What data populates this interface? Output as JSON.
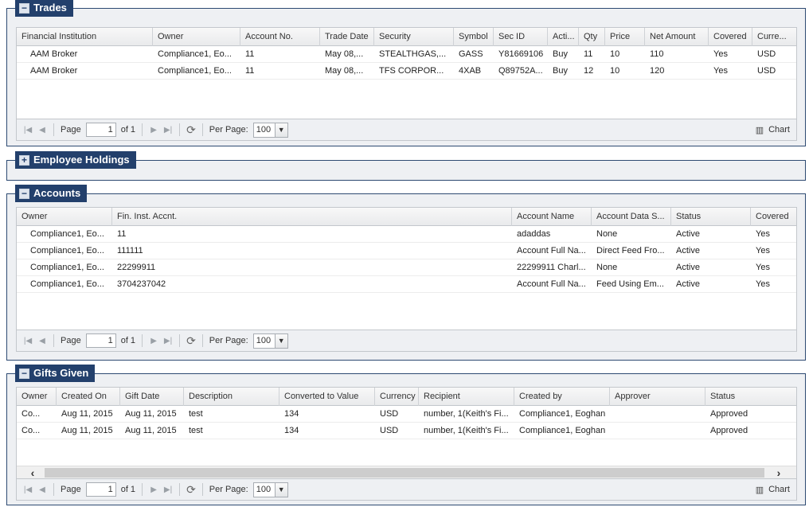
{
  "trades": {
    "title": "Trades",
    "columns": [
      "Financial Institution",
      "Owner",
      "Account No.",
      "Trade Date",
      "Security",
      "Symbol",
      "Sec ID",
      "Acti...",
      "Qty",
      "Price",
      "Net Amount",
      "Covered",
      "Curre..."
    ],
    "rows": [
      [
        "AAM Broker",
        "Compliance1, Eo...",
        "11",
        "May 08,...",
        "STEALTHGAS,...",
        "GASS",
        "Y81669106",
        "Buy",
        "11",
        "10",
        "110",
        "Yes",
        "USD"
      ],
      [
        "AAM Broker",
        "Compliance1, Eo...",
        "11",
        "May 08,...",
        "TFS CORPOR...",
        "4XAB",
        "Q89752A...",
        "Buy",
        "12",
        "10",
        "120",
        "Yes",
        "USD"
      ]
    ],
    "pager": {
      "page_label": "Page",
      "page_value": "1",
      "of_label": "of 1",
      "per_page_label": "Per Page:",
      "per_page_value": "100",
      "chart_label": "Chart"
    }
  },
  "holdings": {
    "title": "Employee Holdings"
  },
  "accounts": {
    "title": "Accounts",
    "columns": [
      "Owner",
      "Fin. Inst. Accnt.",
      "Account Name",
      "Account Data S...",
      "Status",
      "Covered"
    ],
    "rows": [
      [
        "Compliance1, Eo...",
        "11",
        "adaddas",
        "None",
        "Active",
        "Yes"
      ],
      [
        "Compliance1, Eo...",
        "111111",
        "Account Full Na...",
        "Direct Feed Fro...",
        "Active",
        "Yes"
      ],
      [
        "Compliance1, Eo...",
        "22299911",
        "22299911 Charl...",
        "None",
        "Active",
        "Yes"
      ],
      [
        "Compliance1, Eo...",
        "3704237042",
        "Account Full Na...",
        "Feed Using Em...",
        "Active",
        "Yes"
      ]
    ],
    "pager": {
      "page_label": "Page",
      "page_value": "1",
      "of_label": "of 1",
      "per_page_label": "Per Page:",
      "per_page_value": "100"
    }
  },
  "gifts": {
    "title": "Gifts Given",
    "columns": [
      "Owner",
      "Created On",
      "Gift Date",
      "Description",
      "Converted to Value",
      "Currency",
      "Recipient",
      "Created by",
      "Approver",
      "Status"
    ],
    "rows": [
      [
        "Co...",
        "Aug 11, 2015",
        "Aug 11, 2015",
        "test",
        "134",
        "USD",
        "number, 1(Keith's Fi...",
        "Compliance1, Eoghan",
        "",
        "Approved"
      ],
      [
        "Co...",
        "Aug 11, 2015",
        "Aug 11, 2015",
        "test",
        "134",
        "USD",
        "number, 1(Keith's Fi...",
        "Compliance1, Eoghan",
        "",
        "Approved"
      ]
    ],
    "pager": {
      "page_label": "Page",
      "page_value": "1",
      "of_label": "of 1",
      "per_page_label": "Per Page:",
      "per_page_value": "100",
      "chart_label": "Chart"
    }
  }
}
